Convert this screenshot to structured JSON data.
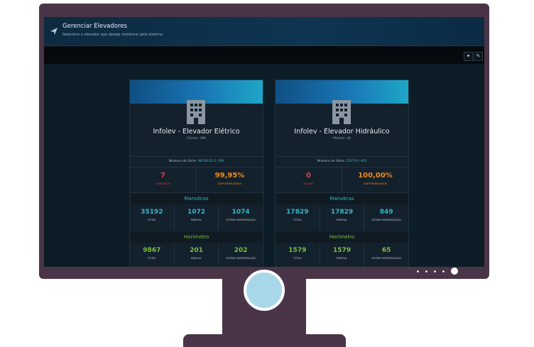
{
  "header": {
    "title": "Gerenciar Elevadores",
    "subtitle": "Selecione o elevador que deseja monitorar pelo sistema"
  },
  "toolbar": {
    "icons": [
      "gear-icon",
      "edit-icon"
    ]
  },
  "cards": [
    {
      "title": "Infolev - Elevador Elétrico",
      "subtitle": "Cliente: 399",
      "serial_label": "Número de Série:",
      "serial_value": "INFOELEV-1-198",
      "status_left_value": "7",
      "status_left_label": "CHAMADOS",
      "status_right_value": "99,95%",
      "status_right_label": "DISPONIBILIDADE",
      "manobras_title": "Manobras",
      "manobras": [
        {
          "value": "35192",
          "label": "TOTAL"
        },
        {
          "value": "1072",
          "label": "PARCIAL"
        },
        {
          "value": "1074",
          "label": "ÚLTIMA ENERGIZAÇÃO"
        }
      ],
      "horimetro_title": "Horímetro",
      "horimetro": [
        {
          "value": "9867",
          "label": "TOTAL"
        },
        {
          "value": "201",
          "label": "PARCIAL"
        },
        {
          "value": "202",
          "label": "ÚLTIMA ENERGIZAÇÃO"
        }
      ]
    },
    {
      "title": "Infolev - Elevador Hidráulico",
      "subtitle": "Modelo: 40",
      "serial_label": "Número de Série:",
      "serial_value": "25079-1-403",
      "status_left_value": "0",
      "status_left_label": "FALHAS",
      "status_right_value": "100,00%",
      "status_right_label": "DISPONIBILIDADE",
      "manobras_title": "Manobras",
      "manobras": [
        {
          "value": "17829",
          "label": "TOTAL"
        },
        {
          "value": "17829",
          "label": "PARCIAL"
        },
        {
          "value": "849",
          "label": "ÚLTIMA ENERGIZAÇÃO"
        }
      ],
      "horimetro_title": "Horímetro",
      "horimetro": [
        {
          "value": "1579",
          "label": "TOTAL"
        },
        {
          "value": "1579",
          "label": "PARCIAL"
        },
        {
          "value": "65",
          "label": "ÚLTIMA ENERGIZAÇÃO"
        }
      ]
    }
  ],
  "pager": {
    "pages": 5,
    "active_page": 5
  },
  "colors": {
    "accent_cyan": "#2fb7c9",
    "accent_green": "#7cbe3e",
    "alert_red": "#e63b46",
    "alert_orange": "#f08a1c",
    "monitor_frame": "#4a3447"
  }
}
